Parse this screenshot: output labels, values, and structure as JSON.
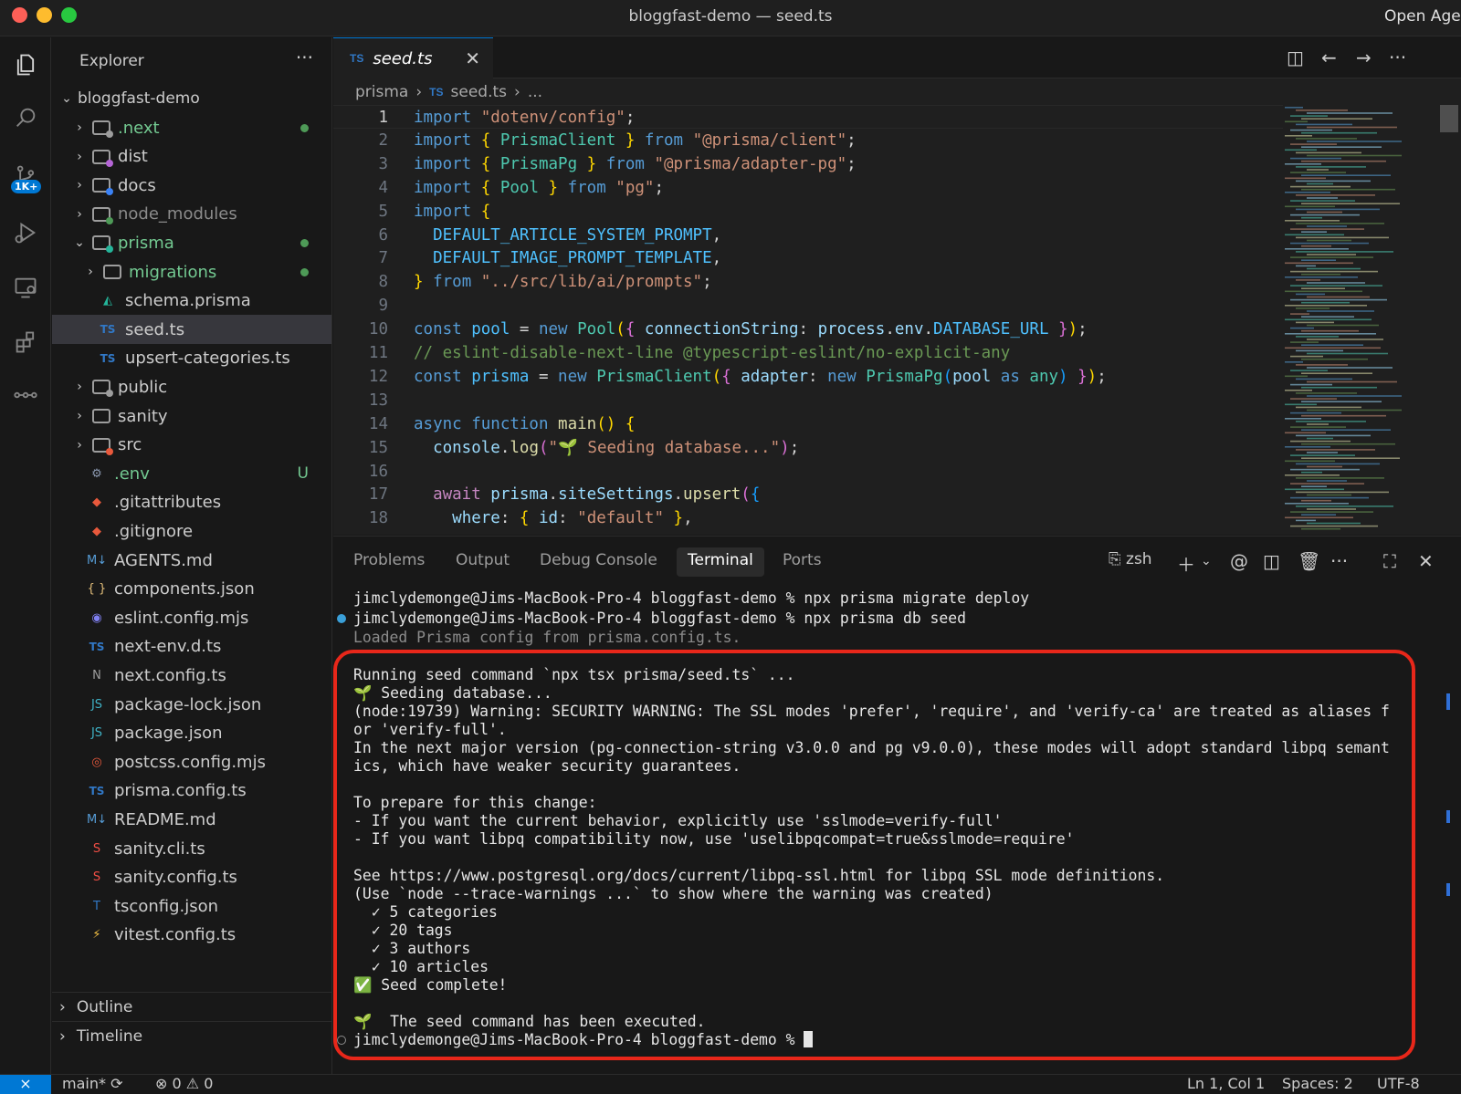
{
  "window": {
    "title": "bloggfast-demo — seed.ts",
    "right_label": "Open Agent"
  },
  "activity": {
    "source_control_badge": "1K+"
  },
  "explorer": {
    "header": "Explorer",
    "root": "bloggfast-demo",
    "items": [
      {
        "label": ".next",
        "type": "folder",
        "color": "#73c991",
        "dot": true
      },
      {
        "label": "dist",
        "type": "folder",
        "color": "#cccccc"
      },
      {
        "label": "docs",
        "type": "folder",
        "color": "#cccccc"
      },
      {
        "label": "node_modules",
        "type": "folder",
        "color": "#8b8b8b"
      },
      {
        "label": "prisma",
        "type": "folder-open",
        "color": "#73c991",
        "dot": true
      },
      {
        "label": "migrations",
        "type": "folder",
        "color": "#73c991",
        "dot": true
      },
      {
        "label": "schema.prisma",
        "type": "file",
        "color": "#cccccc"
      },
      {
        "label": "seed.ts",
        "type": "file",
        "color": "#cccccc"
      },
      {
        "label": "upsert-categories.ts",
        "type": "file",
        "color": "#cccccc"
      },
      {
        "label": "public",
        "type": "folder",
        "color": "#cccccc"
      },
      {
        "label": "sanity",
        "type": "folder",
        "color": "#cccccc"
      },
      {
        "label": "src",
        "type": "folder",
        "color": "#cccccc"
      },
      {
        "label": ".env",
        "type": "file",
        "color": "#73c991",
        "status": "U"
      },
      {
        "label": ".gitattributes",
        "type": "file",
        "color": "#cccccc"
      },
      {
        "label": ".gitignore",
        "type": "file",
        "color": "#cccccc"
      },
      {
        "label": "AGENTS.md",
        "type": "file",
        "color": "#cccccc"
      },
      {
        "label": "components.json",
        "type": "file",
        "color": "#cccccc"
      },
      {
        "label": "eslint.config.mjs",
        "type": "file",
        "color": "#cccccc"
      },
      {
        "label": "next-env.d.ts",
        "type": "file",
        "color": "#cccccc"
      },
      {
        "label": "next.config.ts",
        "type": "file",
        "color": "#cccccc"
      },
      {
        "label": "package-lock.json",
        "type": "file",
        "color": "#cccccc"
      },
      {
        "label": "package.json",
        "type": "file",
        "color": "#cccccc"
      },
      {
        "label": "postcss.config.mjs",
        "type": "file",
        "color": "#cccccc"
      },
      {
        "label": "prisma.config.ts",
        "type": "file",
        "color": "#cccccc"
      },
      {
        "label": "README.md",
        "type": "file",
        "color": "#cccccc"
      },
      {
        "label": "sanity.cli.ts",
        "type": "file",
        "color": "#cccccc"
      },
      {
        "label": "sanity.config.ts",
        "type": "file",
        "color": "#cccccc"
      },
      {
        "label": "tsconfig.json",
        "type": "file",
        "color": "#cccccc"
      },
      {
        "label": "vitest.config.ts",
        "type": "file",
        "color": "#cccccc"
      }
    ],
    "icons": {
      ".next": "",
      "dist": "",
      "docs": "",
      "node_modules": "",
      "prisma": "",
      "migrations": "",
      "schema.prisma": "◭",
      "seed.ts": "TS",
      "upsert-categories.ts": "TS",
      "public": "",
      "sanity": "",
      "src": "",
      ".env": "⚙",
      ".gitattributes": "◆",
      ".gitignore": "◆",
      "AGENTS.md": "M↓",
      "components.json": "{ }",
      "eslint.config.mjs": "◉",
      "next-env.d.ts": "TS",
      "next.config.ts": "N",
      "package-lock.json": "JS",
      "package.json": "JS",
      "postcss.config.mjs": "◎",
      "prisma.config.ts": "TS",
      "README.md": "M↓",
      "sanity.cli.ts": "S",
      "sanity.config.ts": "S",
      "tsconfig.json": "T",
      "vitest.config.ts": "⚡"
    },
    "outline": "Outline",
    "timeline": "Timeline"
  },
  "editor": {
    "tab": {
      "label": "seed.ts",
      "lang": "TS"
    },
    "breadcrumb": [
      "prisma",
      "seed.ts",
      "..."
    ],
    "lines": [
      "1",
      "2",
      "3",
      "4",
      "5",
      "6",
      "7",
      "8",
      "9",
      "10",
      "11",
      "12",
      "13",
      "14",
      "15",
      "16",
      "17",
      "18"
    ],
    "code": [
      [
        [
          "kw",
          "import "
        ],
        [
          "s",
          "\"dotenv/config\""
        ],
        [
          "p",
          ";"
        ]
      ],
      [
        [
          "kw",
          "import "
        ],
        [
          "b1",
          "{ "
        ],
        [
          "t",
          "PrismaClient"
        ],
        [
          "b1",
          " }"
        ],
        [
          "kw",
          " from "
        ],
        [
          "s",
          "\"@prisma/client\""
        ],
        [
          "p",
          ";"
        ]
      ],
      [
        [
          "kw",
          "import "
        ],
        [
          "b1",
          "{ "
        ],
        [
          "t",
          "PrismaPg"
        ],
        [
          "b1",
          " }"
        ],
        [
          "kw",
          " from "
        ],
        [
          "s",
          "\"@prisma/adapter-pg\""
        ],
        [
          "p",
          ";"
        ]
      ],
      [
        [
          "kw",
          "import "
        ],
        [
          "b1",
          "{ "
        ],
        [
          "t",
          "Pool"
        ],
        [
          "b1",
          " }"
        ],
        [
          "kw",
          " from "
        ],
        [
          "s",
          "\"pg\""
        ],
        [
          "p",
          ";"
        ]
      ],
      [
        [
          "kw",
          "import "
        ],
        [
          "b1",
          "{"
        ]
      ],
      [
        [
          "p",
          "  "
        ],
        [
          "cn",
          "DEFAULT_ARTICLE_SYSTEM_PROMPT"
        ],
        [
          "p",
          ","
        ]
      ],
      [
        [
          "p",
          "  "
        ],
        [
          "cn",
          "DEFAULT_IMAGE_PROMPT_TEMPLATE"
        ],
        [
          "p",
          ","
        ]
      ],
      [
        [
          "b1",
          "}"
        ],
        [
          "kw",
          " from "
        ],
        [
          "s",
          "\"../src/lib/ai/prompts\""
        ],
        [
          "p",
          ";"
        ]
      ],
      [],
      [
        [
          "kw",
          "const "
        ],
        [
          "cn",
          "pool"
        ],
        [
          "p",
          " = "
        ],
        [
          "kw",
          "new "
        ],
        [
          "t",
          "Pool"
        ],
        [
          "b1",
          "("
        ],
        [
          "b2",
          "{ "
        ],
        [
          "v",
          "connectionString"
        ],
        [
          "p",
          ": "
        ],
        [
          "v",
          "process"
        ],
        [
          "p",
          "."
        ],
        [
          "v",
          "env"
        ],
        [
          "p",
          "."
        ],
        [
          "cn",
          "DATABASE_URL"
        ],
        [
          "b2",
          " }"
        ],
        [
          "b1",
          ")"
        ],
        [
          "p",
          ";"
        ]
      ],
      [
        [
          "c",
          "// eslint-disable-next-line @typescript-eslint/no-explicit-any"
        ]
      ],
      [
        [
          "kw",
          "const "
        ],
        [
          "cn",
          "prisma"
        ],
        [
          "p",
          " = "
        ],
        [
          "kw",
          "new "
        ],
        [
          "t",
          "PrismaClient"
        ],
        [
          "b1",
          "("
        ],
        [
          "b2",
          "{ "
        ],
        [
          "v",
          "adapter"
        ],
        [
          "p",
          ": "
        ],
        [
          "kw",
          "new "
        ],
        [
          "t",
          "PrismaPg"
        ],
        [
          "b3",
          "("
        ],
        [
          "v",
          "pool"
        ],
        [
          "kw",
          " as "
        ],
        [
          "t",
          "any"
        ],
        [
          "b3",
          ")"
        ],
        [
          "b2",
          " }"
        ],
        [
          "b1",
          ")"
        ],
        [
          "p",
          ";"
        ]
      ],
      [],
      [
        [
          "kw",
          "async "
        ],
        [
          "kw",
          "function "
        ],
        [
          "f",
          "main"
        ],
        [
          "b1",
          "()"
        ],
        [
          "b1",
          " {"
        ]
      ],
      [
        [
          "p",
          "  "
        ],
        [
          "v",
          "console"
        ],
        [
          "p",
          "."
        ],
        [
          "f",
          "log"
        ],
        [
          "b2",
          "("
        ],
        [
          "s",
          "\"🌱 Seeding database...\""
        ],
        [
          "b2",
          ")"
        ],
        [
          "p",
          ";"
        ]
      ],
      [],
      [
        [
          "p",
          "  "
        ],
        [
          "k",
          "await "
        ],
        [
          "v",
          "prisma"
        ],
        [
          "p",
          "."
        ],
        [
          "v",
          "siteSettings"
        ],
        [
          "p",
          "."
        ],
        [
          "f",
          "upsert"
        ],
        [
          "b2",
          "("
        ],
        [
          "b3",
          "{"
        ]
      ],
      [
        [
          "p",
          "    "
        ],
        [
          "v",
          "where"
        ],
        [
          "p",
          ": "
        ],
        [
          "b1",
          "{ "
        ],
        [
          "v",
          "id"
        ],
        [
          "p",
          ": "
        ],
        [
          "s",
          "\"default\""
        ],
        [
          "b1",
          " }"
        ],
        [
          "p",
          ","
        ]
      ]
    ]
  },
  "panel": {
    "tabs": [
      "Problems",
      "Output",
      "Debug Console",
      "Terminal",
      "Ports"
    ],
    "active_tab": "Terminal",
    "shell": "zsh",
    "terminal": [
      "jimclydemonge@Jims-MacBook-Pro-4 bloggfast-demo % npx prisma migrate deploy",
      "jimclydemonge@Jims-MacBook-Pro-4 bloggfast-demo % npx prisma db seed",
      "Loaded Prisma config from prisma.config.ts.",
      "",
      "Running seed command `npx tsx prisma/seed.ts` ...",
      "🌱 Seeding database...",
      "(node:19739) Warning: SECURITY WARNING: The SSL modes 'prefer', 'require', and 'verify-ca' are treated as aliases f",
      "or 'verify-full'.",
      "In the next major version (pg-connection-string v3.0.0 and pg v9.0.0), these modes will adopt standard libpq semant",
      "ics, which have weaker security guarantees.",
      "",
      "To prepare for this change:",
      "- If you want the current behavior, explicitly use 'sslmode=verify-full'",
      "- If you want libpq compatibility now, use 'uselibpqcompat=true&sslmode=require'",
      "",
      "See https://www.postgresql.org/docs/current/libpq-ssl.html for libpq SSL mode definitions.",
      "(Use `node --trace-warnings ...` to show where the warning was created)",
      "  ✓ 5 categories",
      "  ✓ 20 tags",
      "  ✓ 3 authors",
      "  ✓ 10 articles",
      "✅ Seed complete!",
      "",
      "🌱  The seed command has been executed.",
      "jimclydemonge@Jims-MacBook-Pro-4 bloggfast-demo % "
    ]
  },
  "status": {
    "branch": "main*",
    "errors": "0",
    "warnings": "0",
    "position": "Ln 1, Col 1",
    "spaces": "Spaces: 2",
    "encoding": "UTF-8"
  },
  "colors": {
    "accent": "#0078d4",
    "highlight": "#e8271a"
  }
}
